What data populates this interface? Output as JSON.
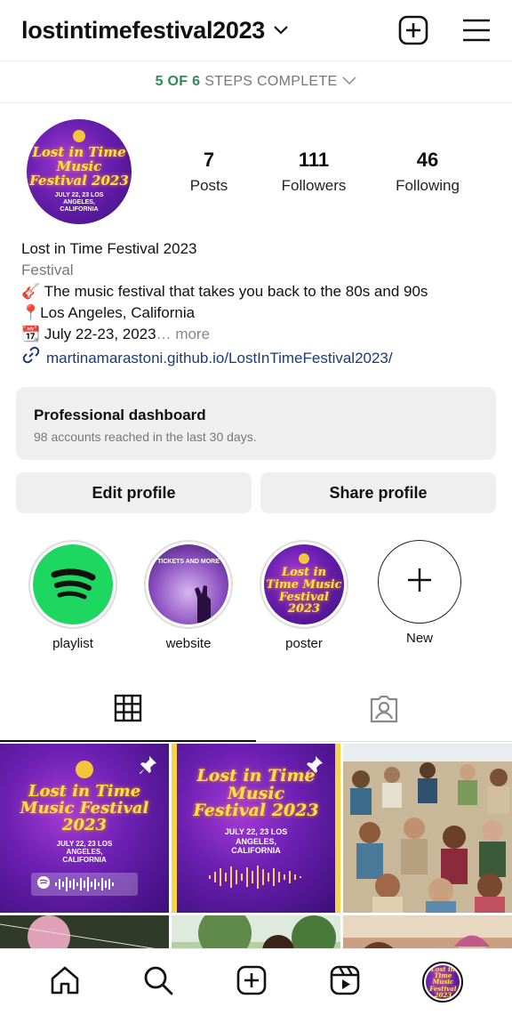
{
  "header": {
    "username": "lostintimefestival2023",
    "steps_highlight": "5 OF 6",
    "steps_rest": "STEPS COMPLETE"
  },
  "profile": {
    "avatar_title": "Lost in Time Music Festival 2023",
    "avatar_sub": "JULY 22, 23 LOS ANGELES, CALIFORNIA",
    "stats": [
      {
        "num": "7",
        "label": "Posts"
      },
      {
        "num": "111",
        "label": "Followers"
      },
      {
        "num": "46",
        "label": "Following"
      }
    ],
    "name": "Lost in Time Festival 2023",
    "category": "Festival",
    "bio_line1": "🎸 The music festival that takes you back to the 80s and 90s",
    "bio_line2": "📍Los Angeles, California",
    "bio_line3": "📆 July 22-23, 2023",
    "bio_more": "… more",
    "link": "martinamarastoni.github.io/LostInTimeFestival2023/"
  },
  "dashboard": {
    "title": "Professional dashboard",
    "subtitle": "98 accounts reached in the last 30 days."
  },
  "buttons": {
    "edit": "Edit profile",
    "share": "Share profile"
  },
  "highlights": [
    {
      "label": "playlist",
      "icon": "spotify-icon",
      "color": "#1ed760"
    },
    {
      "label": "website",
      "overlay": "TICKETS AND MORE"
    },
    {
      "label": "poster"
    },
    {
      "label": "New",
      "icon": "plus-icon"
    }
  ],
  "tabs": [
    {
      "name": "grid-icon",
      "active": true
    },
    {
      "name": "tagged-icon",
      "active": false
    }
  ],
  "posts": [
    {
      "kind": "poster-spotify",
      "title": "Lost in Time Music Festival 2023",
      "sub": "JULY 22, 23 LOS ANGELES, CALIFORNIA",
      "pinned": true
    },
    {
      "kind": "poster-audio",
      "title": "Lost in Time Music Festival 2023",
      "sub": "JULY 22, 23 LOS ANGELES, CALIFORNIA",
      "pinned": true
    },
    {
      "kind": "photo-crowd"
    },
    {
      "kind": "photo-lanterns"
    },
    {
      "kind": "photo-child"
    },
    {
      "kind": "photo-people"
    }
  ],
  "colors": {
    "steps_green": "#2e8b57",
    "link": "#1b3a7a",
    "poster_purple": "#6a1fb0",
    "poster_yellow": "#ffe24a"
  }
}
